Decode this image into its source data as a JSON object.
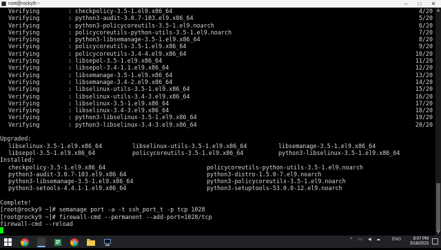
{
  "window": {
    "title": "root@rocky9:~",
    "minimize": "–",
    "maximize": "□",
    "close": "✕"
  },
  "verifying": [
    {
      "action": "Verifying",
      "pkg": ": checkpolicy-3.5-1.el9.x86_64",
      "count": "4/20"
    },
    {
      "action": "Verifying",
      "pkg": ": python3-audit-3.0.7-103.el9.x86_64",
      "count": "5/20"
    },
    {
      "action": "Verifying",
      "pkg": ": python3-policycoreutils-3.5-1.el9.noarch",
      "count": "6/20"
    },
    {
      "action": "Verifying",
      "pkg": ": policycoreutils-python-utils-3.5-1.el9.noarch",
      "count": "7/20"
    },
    {
      "action": "Verifying",
      "pkg": ": python3-libsemanage-3.5-1.el9.x86_64",
      "count": "8/20"
    },
    {
      "action": "Verifying",
      "pkg": ": policycoreutils-3.5-1.el9.x86_64",
      "count": "9/20"
    },
    {
      "action": "Verifying",
      "pkg": ": policycoreutils-3.4-4.el9.x86_64",
      "count": "10/20"
    },
    {
      "action": "Verifying",
      "pkg": ": libsepol-3.5-1.el9.x86_64",
      "count": "11/20"
    },
    {
      "action": "Verifying",
      "pkg": ": libsepol-3.4-1.1.el9.x86_64",
      "count": "12/20"
    },
    {
      "action": "Verifying",
      "pkg": ": libsemanage-3.5-1.el9.x86_64",
      "count": "13/20"
    },
    {
      "action": "Verifying",
      "pkg": ": libsemanage-3.4-2.el9.x86_64",
      "count": "14/20"
    },
    {
      "action": "Verifying",
      "pkg": ": libselinux-utils-3.5-1.el9.x86_64",
      "count": "15/20"
    },
    {
      "action": "Verifying",
      "pkg": ": libselinux-utils-3.4-3.el9.x86_64",
      "count": "16/20"
    },
    {
      "action": "Verifying",
      "pkg": ": libselinux-3.5-1.el9.x86_64",
      "count": "17/20"
    },
    {
      "action": "Verifying",
      "pkg": ": libselinux-3.4-3.el9.x86_64",
      "count": "18/20"
    },
    {
      "action": "Verifying",
      "pkg": ": python3-libselinux-3.5-1.el9.x86_64",
      "count": "19/20"
    },
    {
      "action": "Verifying",
      "pkg": ": python3-libselinux-3.4-3.el9.x86_64",
      "count": "20/20"
    }
  ],
  "upgraded": {
    "heading": "Upgraded:",
    "rows": [
      [
        "libselinux-3.5-1.el9.x86_64",
        "libselinux-utils-3.5-1.el9.x86_64",
        "libsemanage-3.5-1.el9.x86_64"
      ],
      [
        "libsepol-3.5-1.el9.x86_64",
        "policycoreutils-3.5-1.el9.x86_64",
        "python3-libselinux-3.5-1.el9.x86_64"
      ]
    ]
  },
  "installed": {
    "heading": "Installed:",
    "rows": [
      [
        "checkpolicy-3.5-1.el9.x86_64",
        "policycoreutils-python-utils-3.5-1.el9.noarch"
      ],
      [
        "python3-audit-3.0.7-103.el9.x86_64",
        "python3-distro-1.5.0-7.el9.noarch"
      ],
      [
        "python3-libsemanage-3.5-1.el9.x86_64",
        "python3-policycoreutils-3.5-1.el9.noarch"
      ],
      [
        "python3-setools-4.4.1-1.el9.x86_64",
        "python3-setuptools-53.0.0-12.el9.noarch"
      ]
    ]
  },
  "complete": "Complete!",
  "commands": [
    "[root@rocky9 ~]# semanage port -a -t ssh_port_t -p tcp 1028",
    "[root@rocky9 ~]# firewall-cmd --permanent --add-port=1028/tcp",
    "firewall-cmd --reload"
  ],
  "cursor_color": "#00ff00",
  "taskbar": {
    "icons": [
      "windows-start-icon",
      "chrome-icon",
      "terminal-icon",
      "notepad-icon",
      "chrome-icon",
      "folder-icon",
      "putty-icon"
    ],
    "tray": {
      "caret": "^",
      "lang": "ENG"
    },
    "time": "8:07 PM",
    "date": "5/18/2023"
  }
}
